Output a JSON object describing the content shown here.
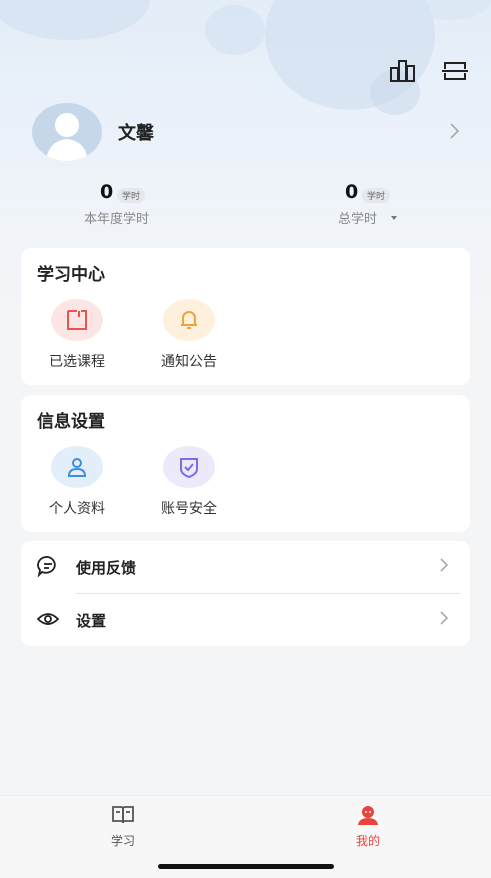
{
  "header": {
    "icons": [
      "stats-icon",
      "scan-icon"
    ]
  },
  "profile": {
    "name": "文馨"
  },
  "stats": {
    "year": {
      "value": "0",
      "unit": "学时",
      "label": "本年度学时"
    },
    "total": {
      "value": "0",
      "unit": "学时",
      "label": "总学时"
    }
  },
  "learning_center": {
    "title": "学习中心",
    "items": [
      {
        "label": "已选课程",
        "icon": "course-icon",
        "color": "#e8544f",
        "bg": "#fbe6e5"
      },
      {
        "label": "通知公告",
        "icon": "bell-icon",
        "color": "#f2a23a",
        "bg": "#fdf0dc"
      }
    ]
  },
  "info_settings": {
    "title": "信息设置",
    "items": [
      {
        "label": "个人资料",
        "icon": "person-icon",
        "color": "#3d8de0",
        "bg": "#e2effb"
      },
      {
        "label": "账号安全",
        "icon": "shield-icon",
        "color": "#7a6ee0",
        "bg": "#ece9fb"
      }
    ]
  },
  "menu": {
    "feedback": "使用反馈",
    "settings": "设置"
  },
  "tabs": {
    "study": "学习",
    "mine": "我的"
  },
  "colors": {
    "accent": "#e8433f",
    "tab_inactive": "#555555"
  }
}
